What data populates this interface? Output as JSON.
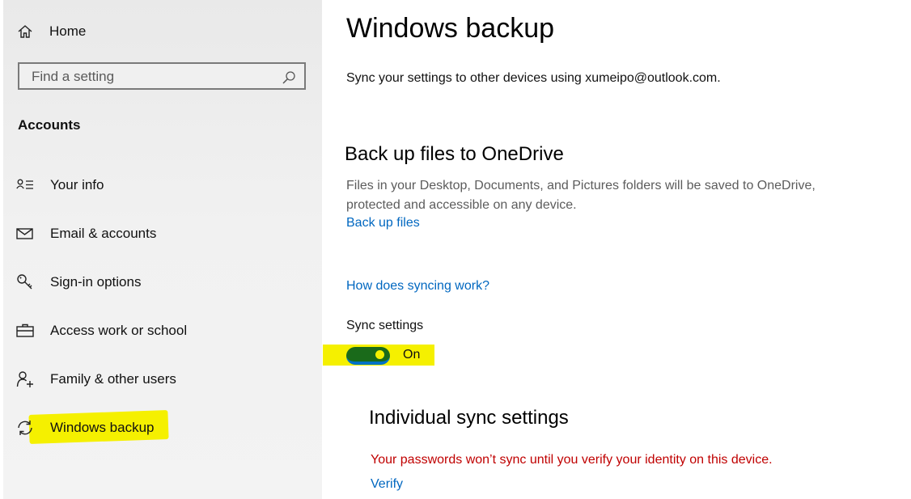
{
  "sidebar": {
    "home_label": "Home",
    "search_placeholder": "Find a setting",
    "section_title": "Accounts",
    "items": [
      {
        "label": "Your info",
        "icon": "person-list-icon"
      },
      {
        "label": "Email & accounts",
        "icon": "mail-icon"
      },
      {
        "label": "Sign-in options",
        "icon": "key-icon"
      },
      {
        "label": "Access work or school",
        "icon": "briefcase-icon"
      },
      {
        "label": "Family & other users",
        "icon": "person-add-icon"
      },
      {
        "label": "Windows backup",
        "icon": "sync-icon",
        "highlighted": true
      }
    ],
    "highlight_color": "#f5f000"
  },
  "main": {
    "title": "Windows backup",
    "intro": "Sync your settings to other devices using xumeipo@outlook.com.",
    "onedrive": {
      "heading": "Back up files to OneDrive",
      "description": "Files in your Desktop, Documents, and Pictures folders will be saved to OneDrive, protected and accessible on any device.",
      "link": "Back up files"
    },
    "how_link": "How does syncing work?",
    "sync": {
      "label": "Sync settings",
      "state": "On",
      "on": true,
      "toggle_color": "#1a6a1a",
      "accent": "#0072c6"
    },
    "individual": {
      "heading": "Individual sync settings",
      "warning": "Your passwords won’t sync until you verify your identity on this device.",
      "warning_color": "#c00000",
      "verify_link": "Verify"
    },
    "link_color": "#0067c0"
  }
}
